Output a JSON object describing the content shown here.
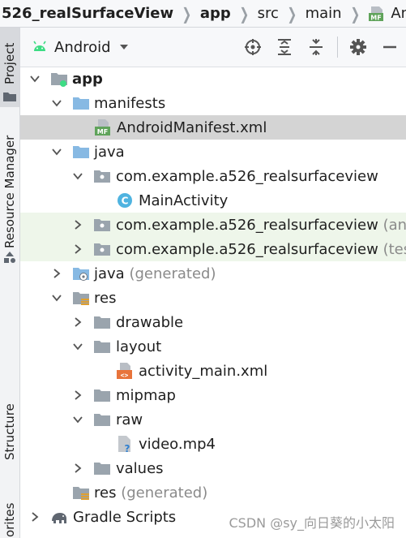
{
  "breadcrumb": {
    "items": [
      "526_realSurfaceView",
      "app",
      "src",
      "main",
      "AndroidM"
    ],
    "last_icon": "manifest-file-icon"
  },
  "sidebar": {
    "project_label": "Project",
    "resource_manager_label": "Resource Manager",
    "structure_label": "Structure",
    "favorites_label": "orites"
  },
  "toolbar": {
    "view_label": "Android",
    "icons": [
      "locate-icon",
      "expand-all-icon",
      "collapse-all-icon",
      "gear-icon",
      "hide-icon"
    ]
  },
  "tree": {
    "app": "app",
    "manifests": "manifests",
    "android_manifest": "AndroidManifest.xml",
    "java": "java",
    "pkg_main": "com.example.a526_realsurfaceview",
    "main_activity": "MainActivity",
    "pkg_android_test": "com.example.a526_realsurfaceview",
    "pkg_android_test_suffix": "(andro",
    "pkg_test": "com.example.a526_realsurfaceview",
    "pkg_test_suffix": "(test)",
    "java_generated": "java",
    "java_generated_suffix": "(generated)",
    "res": "res",
    "drawable": "drawable",
    "layout": "layout",
    "activity_main": "activity_main.xml",
    "mipmap": "mipmap",
    "raw": "raw",
    "video": "video.mp4",
    "values": "values",
    "res_generated": "res",
    "res_generated_suffix": "(generated)",
    "gradle_scripts": "Gradle Scripts"
  },
  "watermark": "CSDN @sy_向日葵的小太阳",
  "colors": {
    "folder_blue": "#87b9e3",
    "folder_grey": "#9aa4ad",
    "android_green": "#3ddc84",
    "selected_bg": "#d4d4d4",
    "test_bg": "#eef6ea",
    "class_icon": "#4fb3e0",
    "xml_orange": "#e8743b"
  }
}
